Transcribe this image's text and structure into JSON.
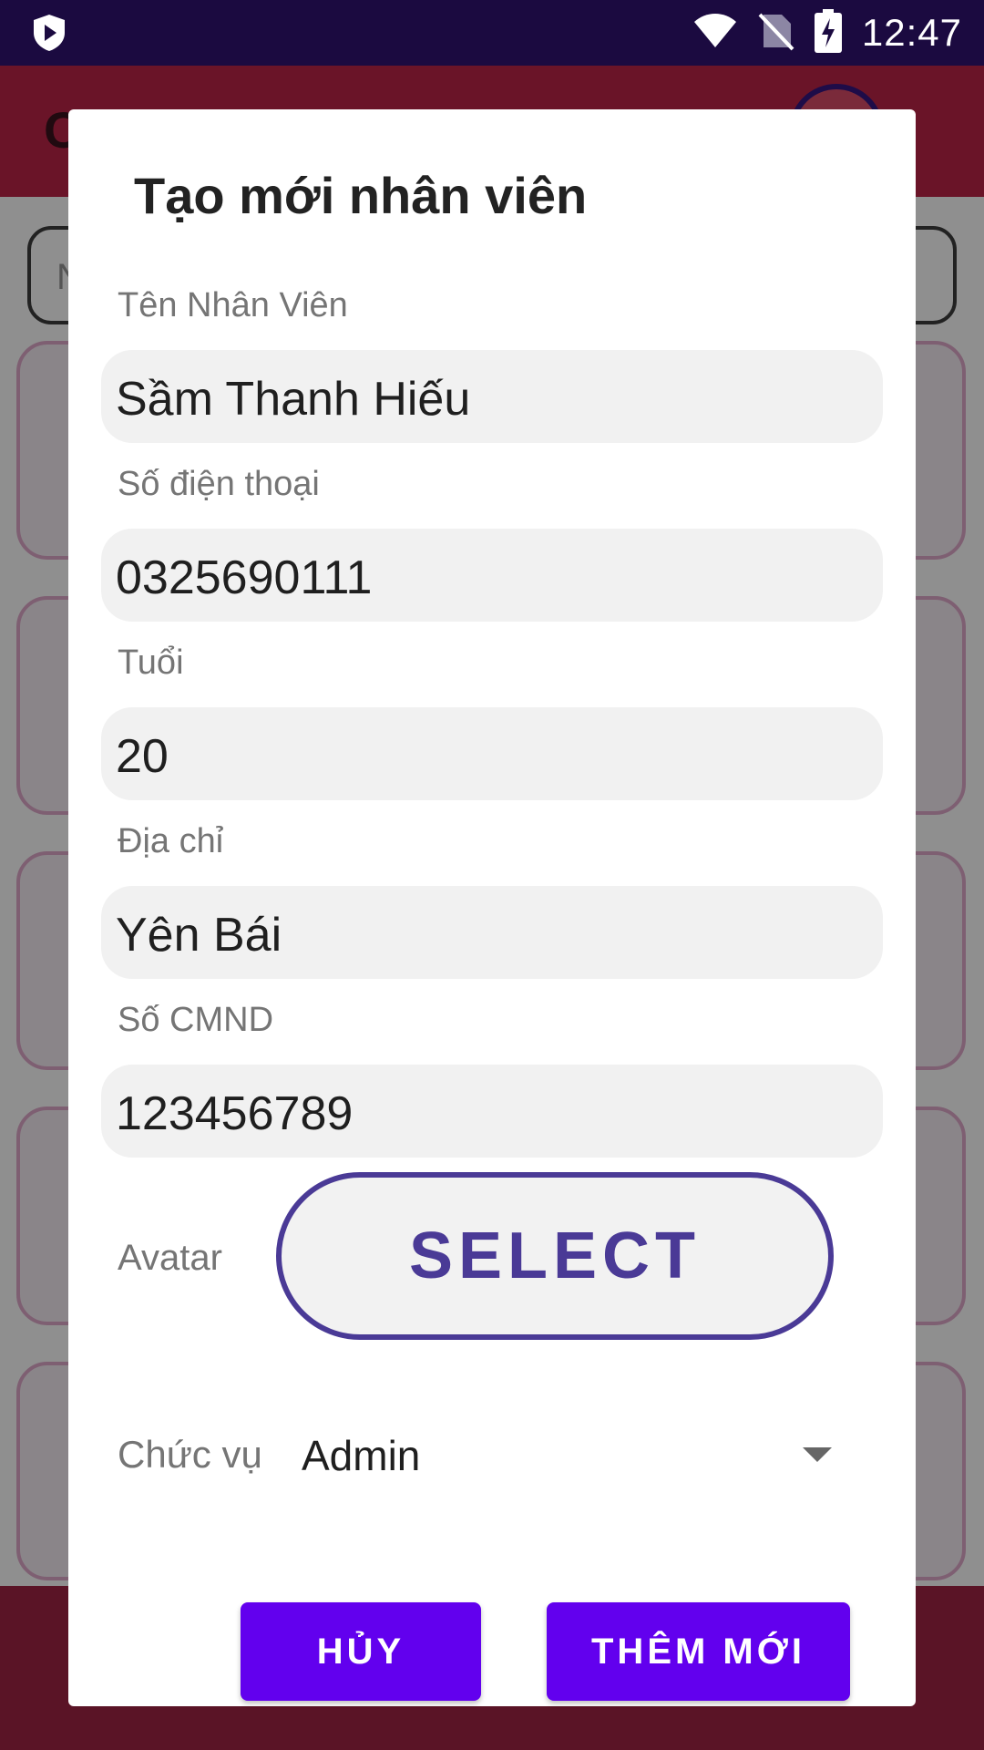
{
  "status_bar": {
    "time": "12:47",
    "icons": [
      "play-protect-icon",
      "wifi-icon",
      "no-sim-icon",
      "battery-charging-icon"
    ]
  },
  "background": {
    "app_title_initial": "C",
    "search_hint_initial": "N"
  },
  "dialog": {
    "title": "Tạo mới nhân viên",
    "fields": [
      {
        "label": "Tên Nhân Viên",
        "value": "Sầm Thanh Hiếu"
      },
      {
        "label": "Số điện thoại",
        "value": "0325690111"
      },
      {
        "label": "Tuổi",
        "value": "20"
      },
      {
        "label": "Địa chỉ",
        "value": "Yên Bái"
      },
      {
        "label": "Số CMND",
        "value": "123456789"
      }
    ],
    "avatar_label": "Avatar",
    "select_label": "SELECT",
    "role_label": "Chức vụ",
    "role_value": "Admin",
    "cancel_label": "HỦY",
    "add_label": "THÊM MỚI"
  },
  "colors": {
    "status_bar": "#1b0a40",
    "accent": "#6200ee",
    "select_outline": "#4a3a96",
    "field_bg": "#f1f1f1"
  }
}
